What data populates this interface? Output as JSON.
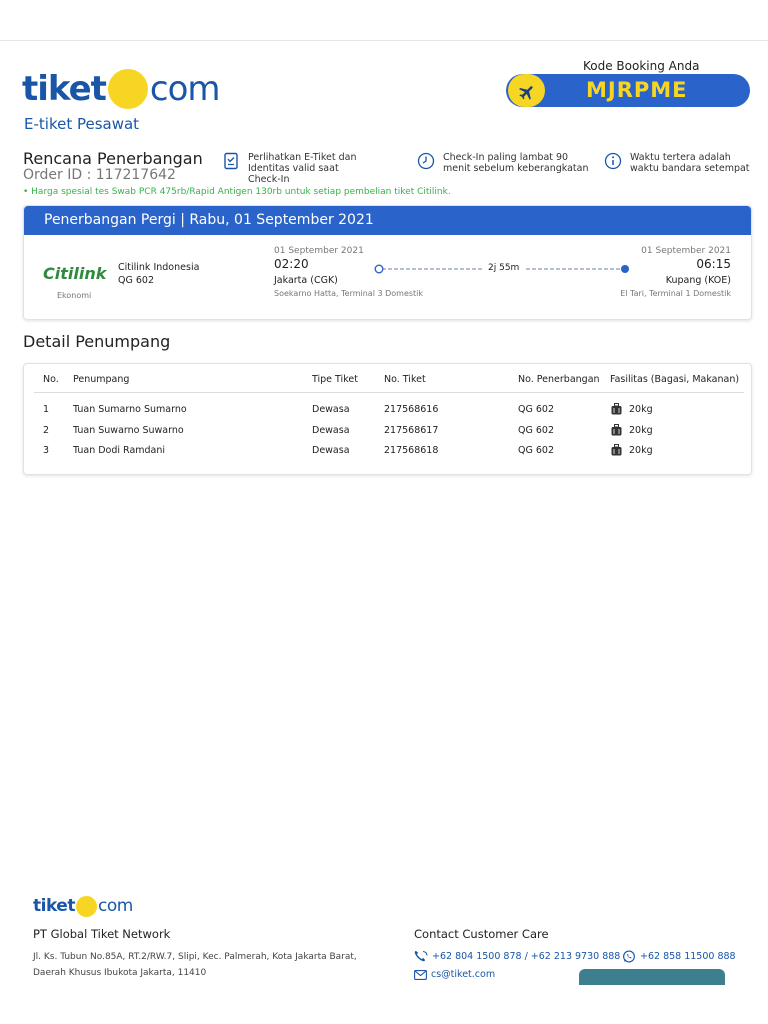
{
  "header": {
    "logo_left": "tiket",
    "logo_right": "com",
    "subtitle": "E-tiket Pesawat",
    "booking_label": "Kode Booking Anda",
    "booking_code": "MJRPME"
  },
  "plan": {
    "title": "Rencana Penerbangan",
    "order_id": "Order ID : 117217642",
    "info1": "Perlihatkan E-Tiket dan Identitas valid saat Check-In",
    "info2": "Check-In paling lambat 90 menit sebelum keberangkatan",
    "info3": "Waktu tertera adalah waktu bandara setempat",
    "promo": "• Harga spesial tes Swab PCR 475rb/Rapid Antigen 130rb untuk setiap pembelian tiket Citilink."
  },
  "flight": {
    "heading": "Penerbangan Pergi | Rabu, 01 September 2021",
    "carrier_logo": "Citilink",
    "airline": "Citilink Indonesia",
    "flight_no": "QG 602",
    "cabin_class": "Ekonomi",
    "dep_date": "01 September 2021",
    "dep_time": "02:20",
    "dep_city": "Jakarta (CGK)",
    "dep_terminal": "Soekarno Hatta, Terminal 3 Domestik",
    "duration": "2j 55m",
    "arr_date": "01 September 2021",
    "arr_time": "06:15",
    "arr_city": "Kupang (KOE)",
    "arr_terminal": "El Tari, Terminal 1 Domestik"
  },
  "passengers": {
    "title": "Detail Penumpang",
    "columns": [
      "No.",
      "Penumpang",
      "Tipe Tiket",
      "No. Tiket",
      "No. Penerbangan",
      "Fasilitas (Bagasi, Makanan)"
    ],
    "rows": [
      {
        "no": "1",
        "name": "Tuan Sumarno Sumarno",
        "type": "Dewasa",
        "ticket": "217568616",
        "flight": "QG 602",
        "baggage": "20kg"
      },
      {
        "no": "2",
        "name": "Tuan Suwarno Suwarno",
        "type": "Dewasa",
        "ticket": "217568617",
        "flight": "QG 602",
        "baggage": "20kg"
      },
      {
        "no": "3",
        "name": "Tuan Dodi Ramdani",
        "type": "Dewasa",
        "ticket": "217568618",
        "flight": "QG 602",
        "baggage": "20kg"
      }
    ]
  },
  "footer": {
    "logo_left": "tiket",
    "logo_right": "com",
    "company": "PT Global Tiket Network",
    "address": "Jl. Ks. Tubun No.85A, RT.2/RW.7, Slipi, Kec. Palmerah, Kota Jakarta Barat, Daerah Khusus Ibukota Jakarta, 11410",
    "cc_title": "Contact Customer Care",
    "phones": "+62 804 1500 878 / +62 213 9730 888",
    "whatsapp": "+62 858 11500 888",
    "email": "cs@tiket.com"
  },
  "colors": {
    "brand_blue": "#2a63c9",
    "brand_yellow": "#f6d623",
    "citilink_green": "#2e8b3e",
    "promo_green": "#3ab04a"
  }
}
